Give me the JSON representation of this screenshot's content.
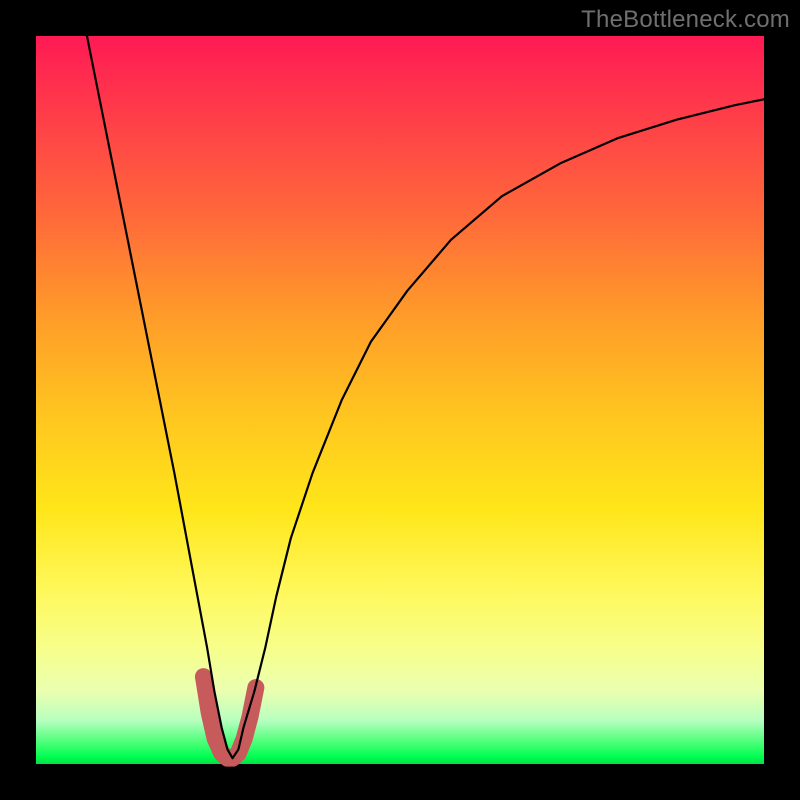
{
  "watermark": "TheBottleneck.com",
  "chart_data": {
    "type": "line",
    "title": "",
    "xlabel": "",
    "ylabel": "",
    "xlim": [
      0,
      100
    ],
    "ylim": [
      0,
      100
    ],
    "series": [
      {
        "name": "bottleneck-curve",
        "x": [
          7,
          9,
          11,
          13,
          15,
          17,
          19,
          20.5,
          22,
          23.5,
          24.5,
          25.5,
          26.3,
          27,
          27.8,
          28.5,
          30,
          31.5,
          33,
          35,
          38,
          42,
          46,
          51,
          57,
          64,
          72,
          80,
          88,
          96,
          100
        ],
        "y": [
          100,
          90,
          80,
          70,
          60,
          50,
          40,
          32,
          24,
          16,
          10,
          5,
          2,
          0.8,
          2,
          5,
          10,
          16,
          23,
          31,
          40,
          50,
          58,
          65,
          72,
          78,
          82.5,
          86,
          88.5,
          90.5,
          91.3
        ]
      },
      {
        "name": "sweet-spot-band",
        "x": [
          23.0,
          23.8,
          24.6,
          25.5,
          26.3,
          27.0,
          27.8,
          28.6,
          29.4,
          30.2
        ],
        "y": [
          12.0,
          7.0,
          3.5,
          1.5,
          0.8,
          0.8,
          1.5,
          3.5,
          6.5,
          10.5
        ]
      }
    ],
    "colors": {
      "curve": "#000000",
      "band": "#c75a5a"
    }
  }
}
